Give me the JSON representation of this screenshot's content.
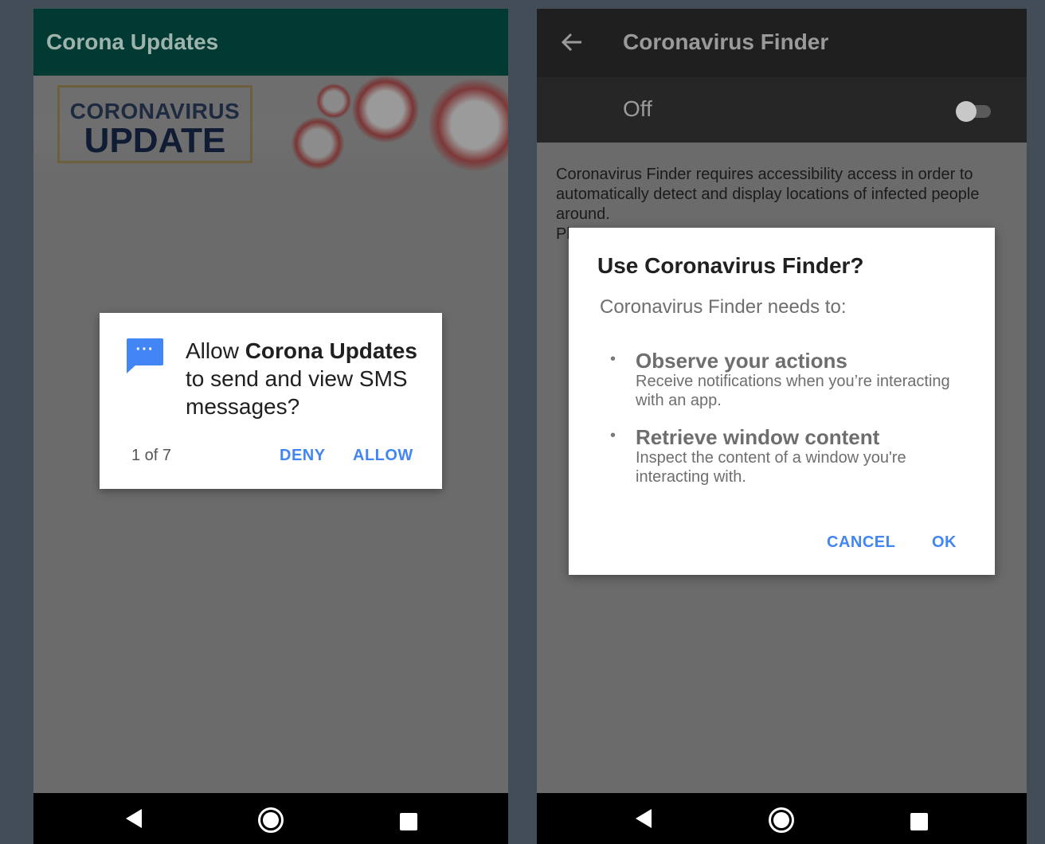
{
  "left": {
    "appbar": {
      "title": "Corona Updates"
    },
    "banner": {
      "line1": "CORONAVIRUS",
      "line2": "UPDATE"
    },
    "dialog": {
      "prefix": "Allow ",
      "app_name": "Corona Updates",
      "suffix": " to send and view SMS messages?",
      "counter": "1 of 7",
      "deny": "DENY",
      "allow": "ALLOW",
      "icon": "sms-message-icon"
    },
    "nav": {
      "back": "back-icon",
      "home": "home-icon",
      "recent": "recent-apps-icon"
    }
  },
  "right": {
    "appbar": {
      "title": "Coronavirus Finder",
      "back_icon": "arrow-left-icon"
    },
    "toggle": {
      "label": "Off",
      "state": "off"
    },
    "description": "Coronavirus Finder requires accessibility access in order to automatically detect and display locations of infected people around.",
    "description_cut": "Pl",
    "dialog": {
      "title": "Use Coronavirus Finder?",
      "subtitle": "Coronavirus Finder needs to:",
      "permissions": [
        {
          "title": "Observe your actions",
          "desc": "Receive notifications when you’re interacting with an app."
        },
        {
          "title": "Retrieve window content",
          "desc": "Inspect the content of a window you're interacting with."
        }
      ],
      "cancel": "CANCEL",
      "ok": "OK"
    }
  },
  "colors": {
    "background": "#434d57",
    "accent": "#4285f4",
    "left_appbar": "#003a32",
    "right_appbar": "#1f1f1f",
    "scrim": "#6b6b6b"
  }
}
